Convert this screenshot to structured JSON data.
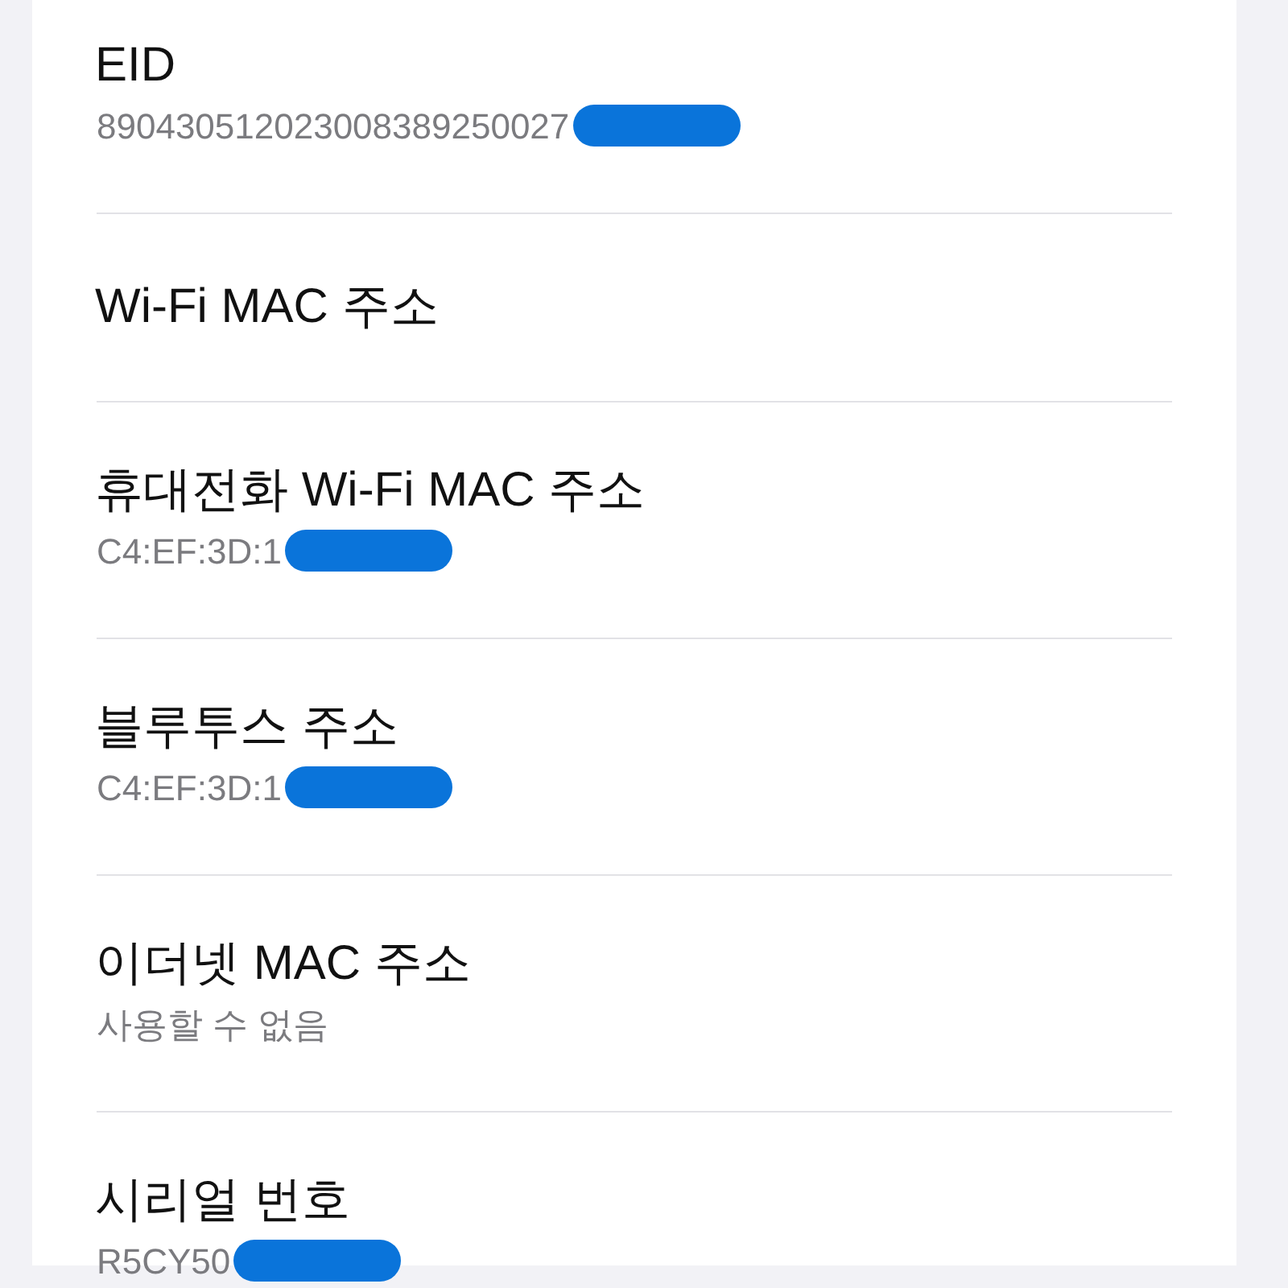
{
  "items": [
    {
      "title": "EID",
      "value": "890430512023008389250027",
      "redacted": true
    },
    {
      "title": "Wi-Fi MAC 주소"
    },
    {
      "title": "휴대전화 Wi-Fi MAC 주소",
      "value": "C4:EF:3D:1",
      "redacted": true
    },
    {
      "title": "블루투스 주소",
      "value": "C4:EF:3D:1",
      "redacted": true
    },
    {
      "title": "이더넷 MAC 주소",
      "value": "사용할 수 없음"
    },
    {
      "title": "시리얼 번호",
      "value": "R5CY50",
      "redacted": true
    }
  ]
}
